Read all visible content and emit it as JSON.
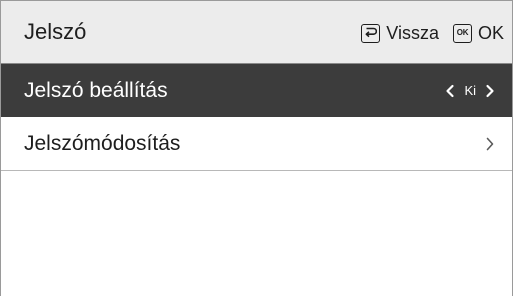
{
  "header": {
    "title": "Jelszó",
    "back_label": "Vissza",
    "ok_label": "OK",
    "ok_icon_text": "OK"
  },
  "menu": {
    "items": [
      {
        "label": "Jelszó beállítás",
        "value": "Ki",
        "selected": true
      },
      {
        "label": "Jelszómódosítás",
        "selected": false
      }
    ]
  },
  "colors": {
    "header_bg": "#ececec",
    "selected_bg": "#3c3c3c",
    "text": "#1e1e1e"
  }
}
